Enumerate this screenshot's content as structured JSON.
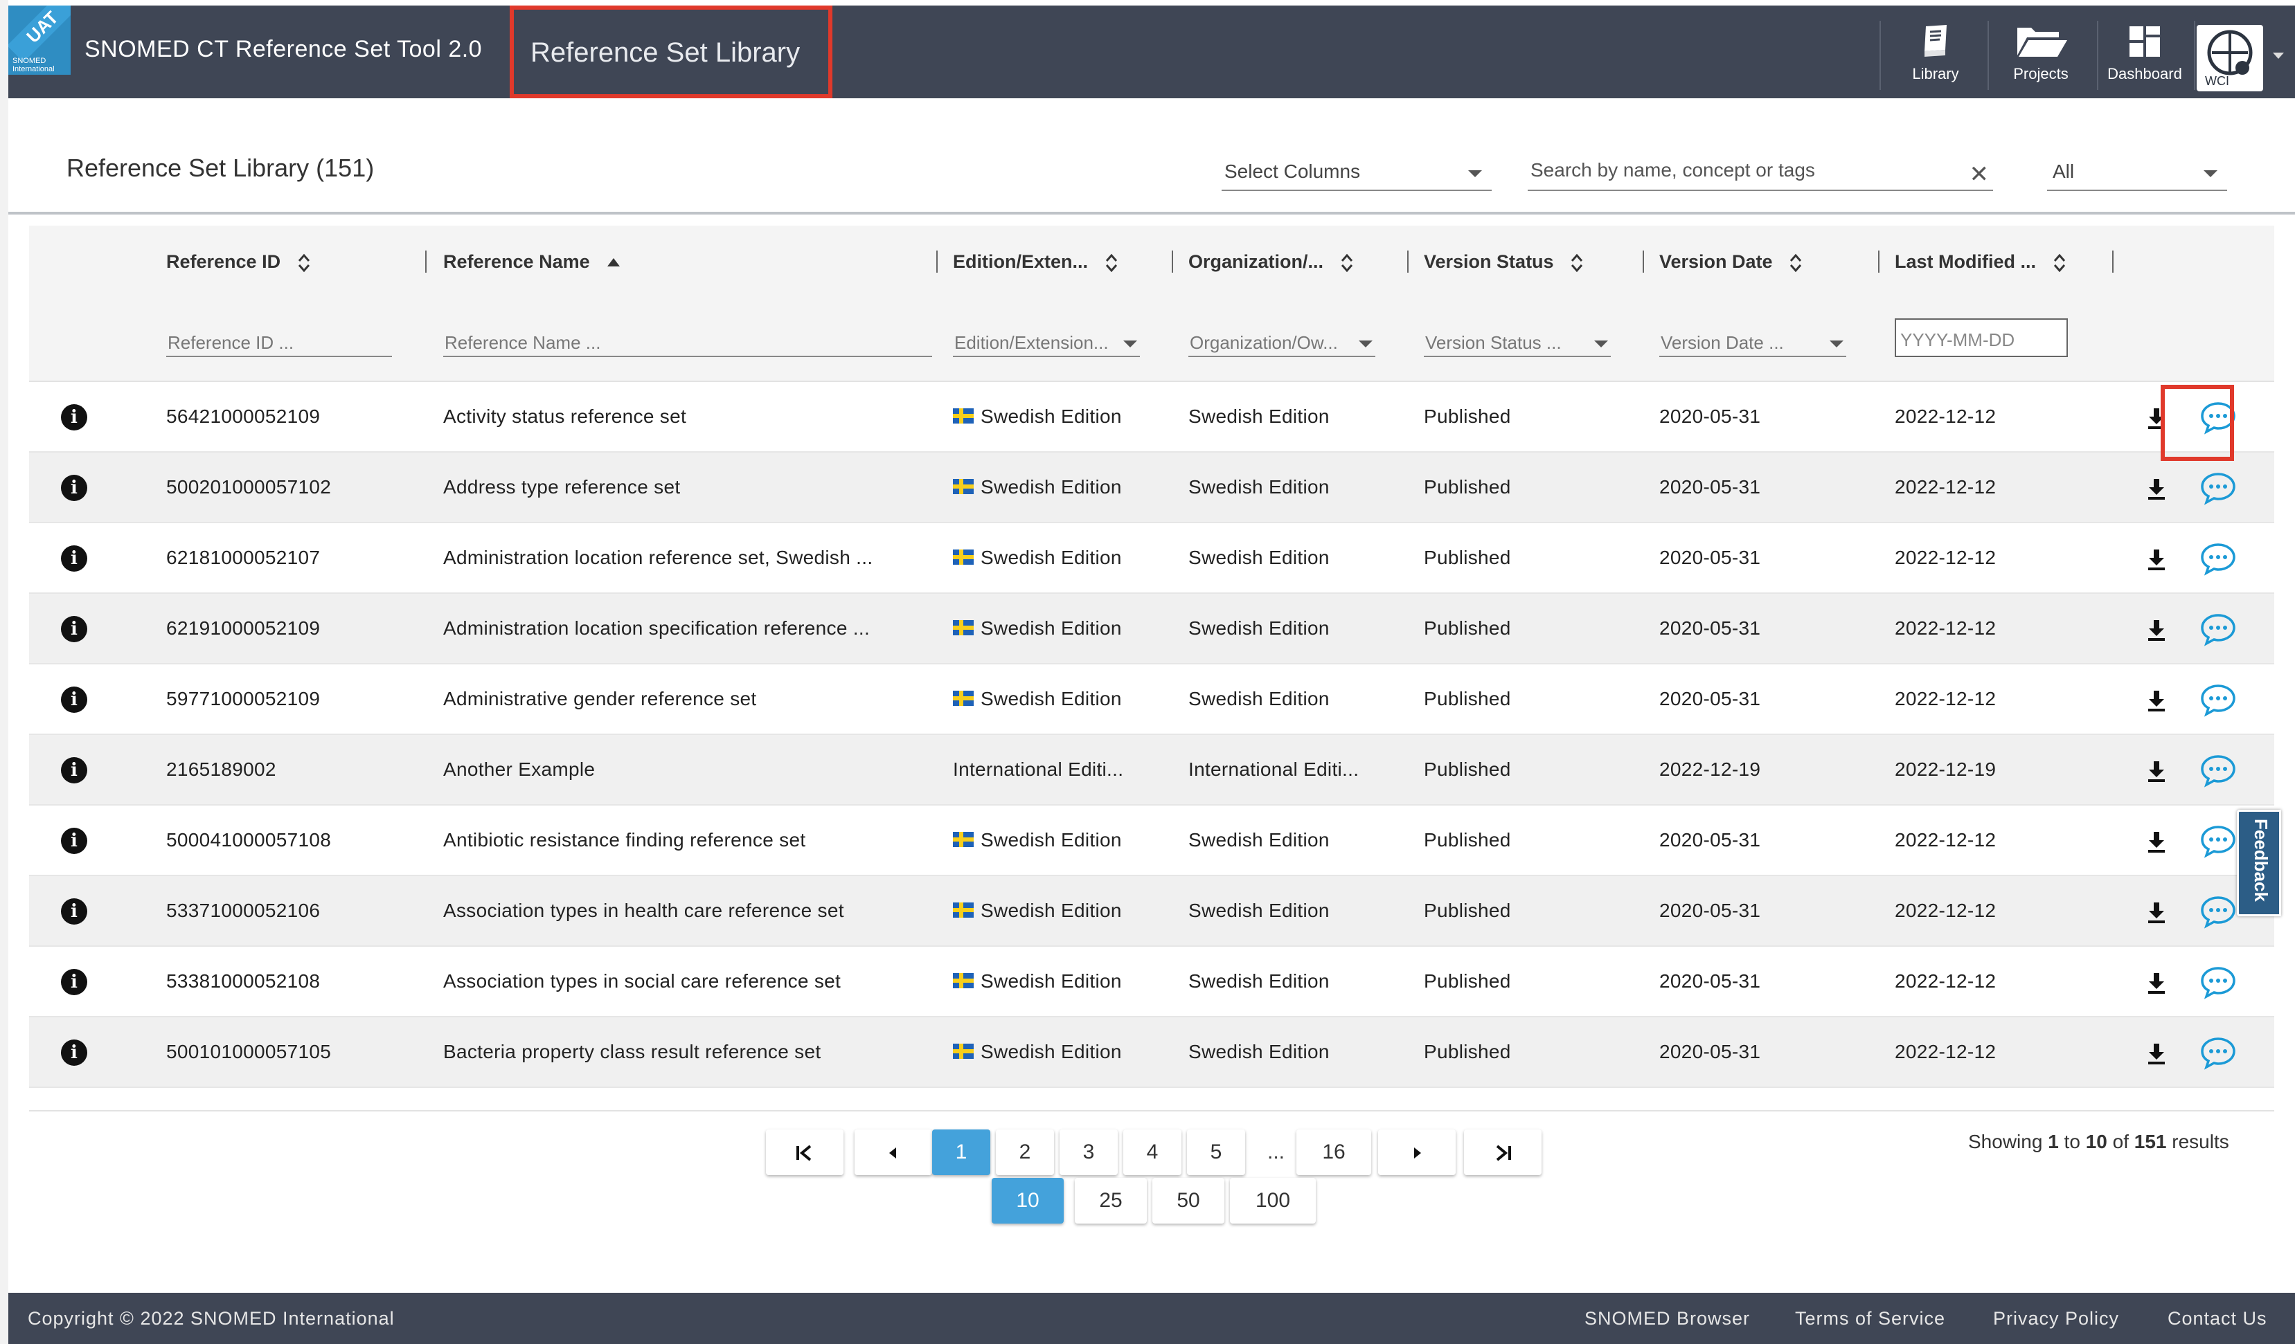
{
  "header": {
    "badge": "UAT",
    "logo_text": "SNOMED International",
    "app_title": "SNOMED CT Reference Set Tool 2.0",
    "page_title": "Reference Set Library",
    "nav": [
      {
        "label": "Library",
        "icon": "book-icon"
      },
      {
        "label": "Projects",
        "icon": "folder-icon"
      },
      {
        "label": "Dashboard",
        "icon": "dashboard-icon"
      }
    ],
    "user": "WCI"
  },
  "card": {
    "title": "Reference Set Library (151)",
    "select_columns": "Select Columns",
    "search_placeholder": "Search by name, concept or tags",
    "scope_filter": "All"
  },
  "columns": [
    {
      "label": "Reference ID",
      "filter": "Reference ID ...",
      "sort": "both"
    },
    {
      "label": "Reference Name",
      "filter": "Reference Name ...",
      "sort": "asc"
    },
    {
      "label": "Edition/Exten...",
      "filter": "Edition/Extension...",
      "sort": "both"
    },
    {
      "label": "Organization/...",
      "filter": "Organization/Ow...",
      "sort": "both"
    },
    {
      "label": "Version Status",
      "filter": "Version Status ...",
      "sort": "both"
    },
    {
      "label": "Version Date",
      "filter": "Version Date ...",
      "sort": "both"
    },
    {
      "label": "Last Modified ...",
      "filter": "YYYY-MM-DD",
      "sort": "both"
    }
  ],
  "rows": [
    {
      "id": "56421000052109",
      "name": "Activity status reference set",
      "edition": "Swedish Edition",
      "flag": true,
      "org": "Swedish Edition",
      "status": "Published",
      "version_date": "2020-05-31",
      "modified": "2022-12-12"
    },
    {
      "id": "500201000057102",
      "name": "Address type reference set",
      "edition": "Swedish Edition",
      "flag": true,
      "org": "Swedish Edition",
      "status": "Published",
      "version_date": "2020-05-31",
      "modified": "2022-12-12"
    },
    {
      "id": "62181000052107",
      "name": "Administration location reference set, Swedish ...",
      "edition": "Swedish Edition",
      "flag": true,
      "org": "Swedish Edition",
      "status": "Published",
      "version_date": "2020-05-31",
      "modified": "2022-12-12"
    },
    {
      "id": "62191000052109",
      "name": "Administration location specification reference ...",
      "edition": "Swedish Edition",
      "flag": true,
      "org": "Swedish Edition",
      "status": "Published",
      "version_date": "2020-05-31",
      "modified": "2022-12-12"
    },
    {
      "id": "59771000052109",
      "name": "Administrative gender reference set",
      "edition": "Swedish Edition",
      "flag": true,
      "org": "Swedish Edition",
      "status": "Published",
      "version_date": "2020-05-31",
      "modified": "2022-12-12"
    },
    {
      "id": "2165189002",
      "name": "Another Example",
      "edition": "International Editi...",
      "flag": false,
      "org": "International Editi...",
      "status": "Published",
      "version_date": "2022-12-19",
      "modified": "2022-12-19"
    },
    {
      "id": "500041000057108",
      "name": "Antibiotic resistance finding reference set",
      "edition": "Swedish Edition",
      "flag": true,
      "org": "Swedish Edition",
      "status": "Published",
      "version_date": "2020-05-31",
      "modified": "2022-12-12"
    },
    {
      "id": "53371000052106",
      "name": "Association types in health care reference set",
      "edition": "Swedish Edition",
      "flag": true,
      "org": "Swedish Edition",
      "status": "Published",
      "version_date": "2020-05-31",
      "modified": "2022-12-12"
    },
    {
      "id": "53381000052108",
      "name": "Association types in social care reference set",
      "edition": "Swedish Edition",
      "flag": true,
      "org": "Swedish Edition",
      "status": "Published",
      "version_date": "2020-05-31",
      "modified": "2022-12-12"
    },
    {
      "id": "500101000057105",
      "name": "Bacteria property class result reference set",
      "edition": "Swedish Edition",
      "flag": true,
      "org": "Swedish Edition",
      "status": "Published",
      "version_date": "2020-05-31",
      "modified": "2022-12-12"
    }
  ],
  "feedback_label": "Feedback",
  "pagination": {
    "pages": [
      "1",
      "2",
      "3",
      "4",
      "5",
      "...",
      "16"
    ],
    "current_page": "1",
    "page_sizes": [
      "10",
      "25",
      "50",
      "100"
    ],
    "current_size": "10",
    "showing_prefix": "Showing",
    "from": "1",
    "to_word": "to",
    "to": "10",
    "of_word": "of",
    "total": "151",
    "suffix": "results"
  },
  "footer": {
    "copyright": "Copyright © 2022 SNOMED International",
    "links": [
      "SNOMED Browser",
      "Terms of Service",
      "Privacy Policy",
      "Contact Us"
    ]
  },
  "colors": {
    "header_bg": "#3f4655",
    "accent": "#44a2db",
    "highlight": "#e0392b",
    "chat_icon": "#1b9ad6"
  }
}
